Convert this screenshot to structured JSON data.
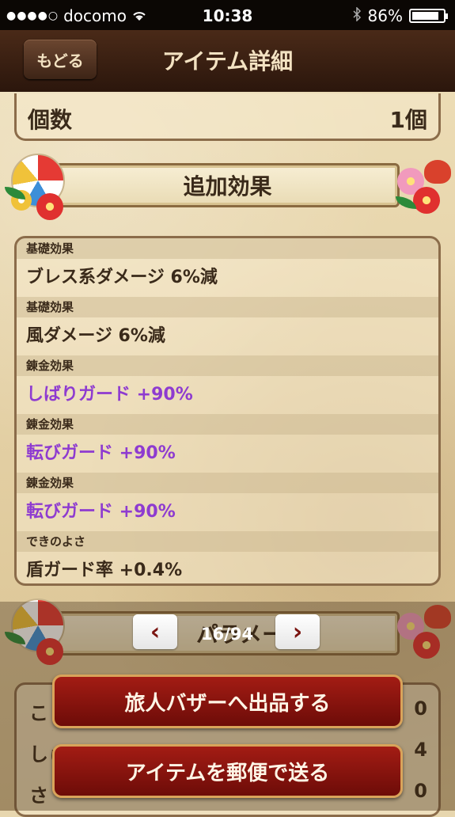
{
  "status_bar": {
    "carrier": "docomo",
    "signal": "●●●●○",
    "time": "10:38",
    "battery_text": "86%",
    "battery_level": 0.86
  },
  "nav": {
    "back_label": "もどる",
    "title": "アイテム詳細"
  },
  "count": {
    "label": "個数",
    "value": "1個"
  },
  "effects": {
    "title": "追加効果",
    "rows": [
      {
        "head": "基礎効果",
        "value": "ブレス系ダメージ 6%減"
      },
      {
        "head": "基礎効果",
        "value": "風ダメージ 6%減"
      },
      {
        "head": "錬金効果",
        "value": "しばりガード +90%"
      },
      {
        "head": "錬金効果",
        "value": "転びガード +90%"
      },
      {
        "head": "錬金効果",
        "value": "転びガード +90%"
      },
      {
        "head": "できのよさ",
        "value": "盾ガード率 +0.4%"
      }
    ]
  },
  "params": {
    "title": "パラメータ",
    "rows": [
      {
        "label": "こ",
        "value": "0"
      },
      {
        "label": "しゅびカ",
        "value": "4"
      },
      {
        "label": "さ",
        "value": "0"
      }
    ]
  },
  "pager": {
    "text": "16/94",
    "prev": "‹",
    "next": "›"
  },
  "actions": {
    "sell": "旅人バザーへ出品する",
    "mail": "アイテムを郵便で送る"
  },
  "colors": {
    "accent_red": "#a31c14",
    "effect_purple": "#8e3bd0"
  }
}
